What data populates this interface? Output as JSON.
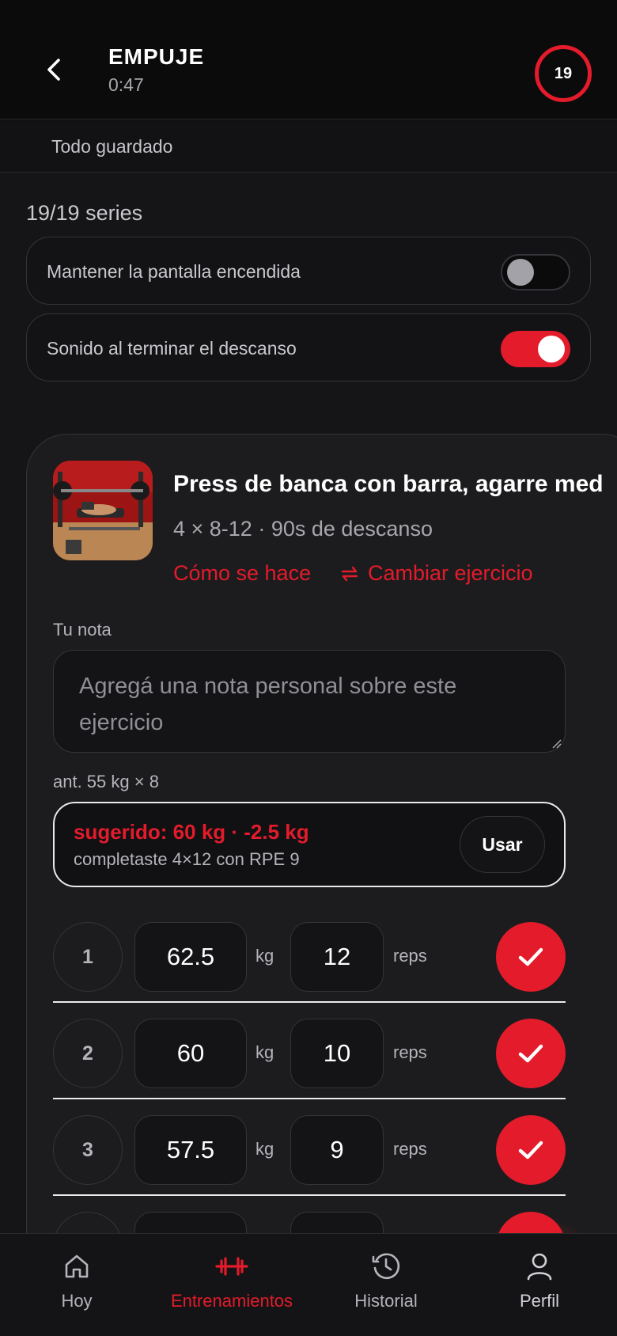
{
  "header": {
    "title": "EMPUJE",
    "timer": "0:47",
    "counter": "19"
  },
  "save_status": "Todo guardado",
  "series_count": "19/19 series",
  "settings": {
    "keep_screen_on": {
      "label": "Mantener la pantalla encendida",
      "enabled": false
    },
    "rest_sound": {
      "label": "Sonido al terminar el descanso",
      "enabled": true
    }
  },
  "exercise": {
    "name": "Press de banca con barra, agarre med",
    "meta": "4 × 8-12 · 90s de descanso",
    "how_link": "Cómo se hace",
    "change_link": "Cambiar ejercicio",
    "note_label": "Tu nota",
    "note_placeholder": "Agregá una nota personal sobre este ejercicio",
    "previous": "ant. 55 kg × 8",
    "suggestion": {
      "title": "sugerido: 60 kg · -2.5 kg",
      "subtitle": "completaste 4×12 con RPE 9",
      "use_label": "Usar"
    },
    "sets": [
      {
        "num": "1",
        "kg": "62.5",
        "kg_unit": "kg",
        "reps": "12",
        "reps_unit": "reps",
        "done": true
      },
      {
        "num": "2",
        "kg": "60",
        "kg_unit": "kg",
        "reps": "10",
        "reps_unit": "reps",
        "done": true
      },
      {
        "num": "3",
        "kg": "57.5",
        "kg_unit": "kg",
        "reps": "9",
        "reps_unit": "reps",
        "done": true
      }
    ]
  },
  "tabs": [
    {
      "label": "Hoy",
      "icon": "home-icon",
      "active": false
    },
    {
      "label": "Entrenamientos",
      "icon": "dumbbell-icon",
      "active": true
    },
    {
      "label": "Historial",
      "icon": "history-icon",
      "active": false
    },
    {
      "label": "Perfil",
      "icon": "user-icon",
      "active": false
    }
  ],
  "colors": {
    "accent": "#e31b2b",
    "background": "#0b0b0c",
    "card": "#1c1c1e"
  }
}
